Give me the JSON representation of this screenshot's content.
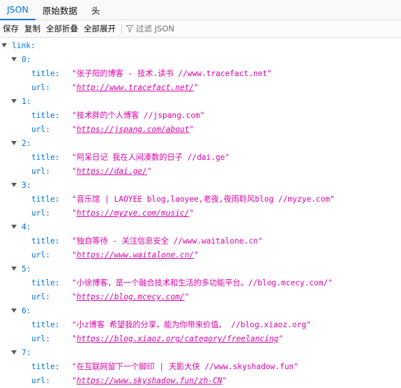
{
  "tabs": [
    "JSON",
    "原始数据",
    "头"
  ],
  "toolbar": {
    "save": "保存",
    "copy": "复制",
    "collapse_all": "全部折叠",
    "expand_all": "全部展开",
    "filter_placeholder": "过滤 JSON"
  },
  "root_key": "link:",
  "field_keys": {
    "title": "title:",
    "url": "url:"
  },
  "items": [
    {
      "index": "0:",
      "title": "张子阳的博客 - 技术.读书 //www.tracefact.net",
      "url": "http://www.tracefact.net/"
    },
    {
      "index": "1:",
      "title": "技术胖的个人博客 //jspang.com",
      "url": "https://jspang.com/about"
    },
    {
      "index": "2:",
      "title": "阿呆日记  我在人间凑数的日子  //dai.ge",
      "url": "https://dai.ge/"
    },
    {
      "index": "3:",
      "title": "音乐馆 | LAOYEE  blog,laoyee,老夜,夜雨聆风blog //myzye.com",
      "url": "https://myzye.com/music/"
    },
    {
      "index": "4:",
      "title": "独自等待 - 关注信息安全 //www.waitalone.cn",
      "url": "https://www.waitalone.cn/"
    },
    {
      "index": "5:",
      "title": "小徐博客，是一个融合技术和生活的多功能平台。//blog.mcecy.com/",
      "url": "https://blog.mcecy.com/"
    },
    {
      "index": "6:",
      "title": "小z博客 希望我的分享，能为你带来价值。 //blog.xiaoz.org",
      "url": "https://blog.xiaoz.org/category/freelancing"
    },
    {
      "index": "7:",
      "title": "在互联网留下一个脚印 | 天影大侠  //www.skyshadow.fun",
      "url": "https://www.skyshadow.fun/zh-CN"
    }
  ]
}
